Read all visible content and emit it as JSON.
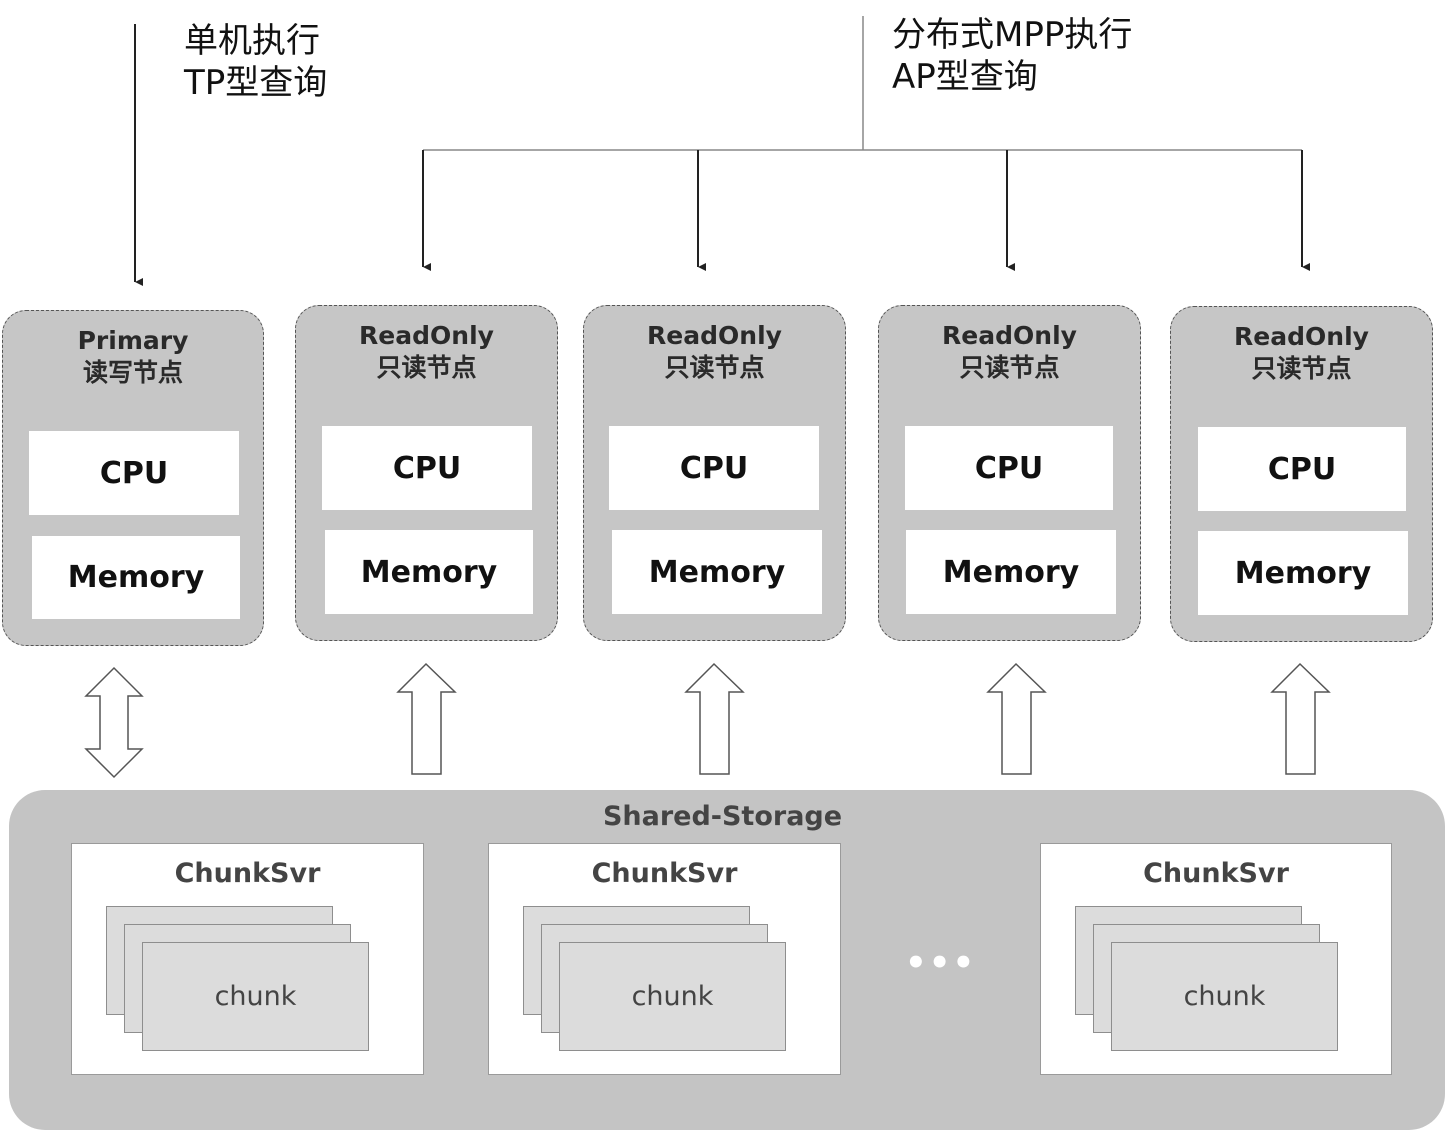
{
  "top_labels": {
    "tp": {
      "line1": "单机执行",
      "line2": "TP型查询"
    },
    "ap": {
      "line1": "分布式MPP执行",
      "line2": "AP型查询"
    }
  },
  "nodes": [
    {
      "title": "Primary",
      "subtitle": "读写节点",
      "cpu": "CPU",
      "memory": "Memory",
      "link": "bidirectional"
    },
    {
      "title": "ReadOnly",
      "subtitle": "只读节点",
      "cpu": "CPU",
      "memory": "Memory",
      "link": "up"
    },
    {
      "title": "ReadOnly",
      "subtitle": "只读节点",
      "cpu": "CPU",
      "memory": "Memory",
      "link": "up"
    },
    {
      "title": "ReadOnly",
      "subtitle": "只读节点",
      "cpu": "CPU",
      "memory": "Memory",
      "link": "up"
    },
    {
      "title": "ReadOnly",
      "subtitle": "只读节点",
      "cpu": "CPU",
      "memory": "Memory",
      "link": "up"
    }
  ],
  "storage": {
    "title": "Shared-Storage",
    "servers": [
      {
        "title": "ChunkSvr",
        "chunk_label": "chunk"
      },
      {
        "title": "ChunkSvr",
        "chunk_label": "chunk"
      },
      {
        "title": "ChunkSvr",
        "chunk_label": "chunk"
      }
    ],
    "ellipsis": "•••"
  },
  "colors": {
    "node_fill": "#c6c6c6",
    "storage_fill": "#c4c4c4",
    "chunk_fill": "#dcdcdc"
  }
}
